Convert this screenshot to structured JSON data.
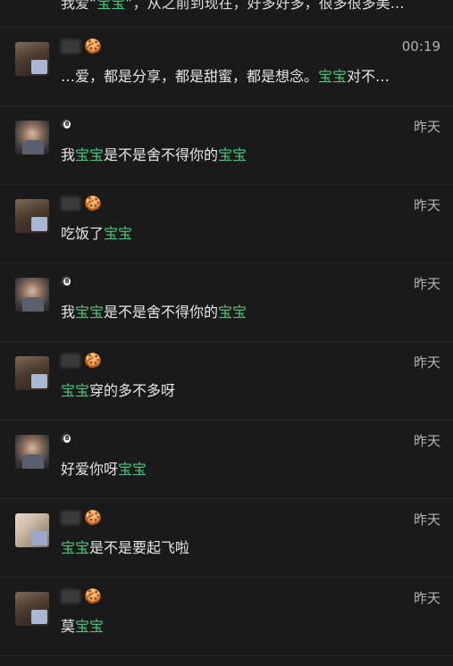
{
  "top_fragment": "我爱“宝宝”，从之前到现在，好多好多，很多很多美…",
  "chats": [
    {
      "avatar": "kind-a",
      "name": "",
      "badge": "cookie",
      "time": "00:19",
      "message": [
        {
          "t": "…爱，都是分享，都是甜蜜，都是想念。",
          "h": false
        },
        {
          "t": "宝宝",
          "h": true
        },
        {
          "t": "对不…",
          "h": false
        }
      ]
    },
    {
      "avatar": "kind-b",
      "name": "",
      "badge": "8ball",
      "time": "昨天",
      "message": [
        {
          "t": "我",
          "h": false
        },
        {
          "t": "宝宝",
          "h": true
        },
        {
          "t": "是不是舍不得你的",
          "h": false
        },
        {
          "t": "宝宝",
          "h": true
        }
      ]
    },
    {
      "avatar": "kind-a",
      "name": "",
      "badge": "cookie",
      "time": "昨天",
      "message": [
        {
          "t": "吃饭了",
          "h": false
        },
        {
          "t": "宝宝",
          "h": true
        }
      ]
    },
    {
      "avatar": "kind-b",
      "name": "",
      "badge": "8ball",
      "time": "昨天",
      "message": [
        {
          "t": "我",
          "h": false
        },
        {
          "t": "宝宝",
          "h": true
        },
        {
          "t": "是不是舍不得你的",
          "h": false
        },
        {
          "t": "宝宝",
          "h": true
        }
      ]
    },
    {
      "avatar": "kind-a",
      "name": "",
      "badge": "cookie",
      "time": "昨天",
      "message": [
        {
          "t": "宝宝",
          "h": true
        },
        {
          "t": "穿的多不多呀",
          "h": false
        }
      ]
    },
    {
      "avatar": "kind-b",
      "name": "",
      "badge": "8ball",
      "time": "昨天",
      "message": [
        {
          "t": "好爱你呀",
          "h": false
        },
        {
          "t": "宝宝",
          "h": true
        }
      ]
    },
    {
      "avatar": "kind-c",
      "name": "",
      "badge": "cookie",
      "time": "昨天",
      "message": [
        {
          "t": "宝宝",
          "h": true
        },
        {
          "t": "是不是要起飞啦",
          "h": false
        }
      ]
    },
    {
      "avatar": "kind-a",
      "name": "",
      "badge": "cookie",
      "time": "昨天",
      "message": [
        {
          "t": "莫",
          "h": false
        },
        {
          "t": "宝宝",
          "h": true
        }
      ]
    }
  ],
  "colors": {
    "background": "#1a1a1a",
    "highlight": "#4ec27a",
    "text": "#e6e6e6",
    "time": "#b3b3b3",
    "divider": "#262626"
  }
}
